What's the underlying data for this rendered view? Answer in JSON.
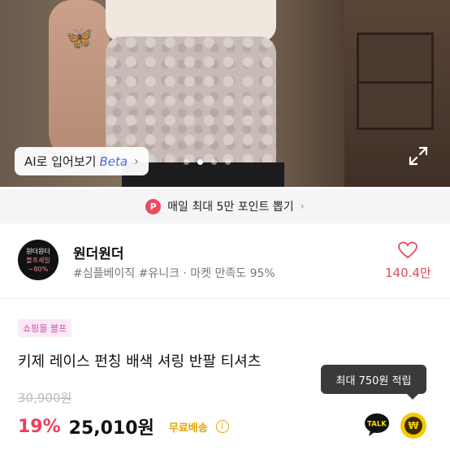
{
  "hero": {
    "ai_try_on_label": "AI로 입어보기",
    "ai_try_on_beta": "Beta",
    "ai_try_on_chevron": "›",
    "expand_icon": "expand-icon",
    "carousel_total": 4,
    "carousel_active_index": 1
  },
  "point_banner": {
    "badge": "P",
    "text": "매일 최대 5만 포인트 뽑기",
    "chevron": "›"
  },
  "shop": {
    "logo_line1": "원더원더",
    "logo_line2": "블프세일",
    "logo_line3": "~80%",
    "name": "원더원더",
    "tags": "#심플베이직 #유니크 · 마켓 만족도 95%",
    "like_count": "140.4만"
  },
  "product": {
    "mall_badge": "쇼핑몰 블프",
    "title": "키제 레이스 펀칭 배색 셔링 반팔 티셔츠",
    "original_price": "30,900원",
    "discount": "19%",
    "price": "25,010원",
    "shipping": "무료배송",
    "info_icon_glyph": "i"
  },
  "tooltip": {
    "text": "최대 750원 적립"
  },
  "actions": {
    "talk_label": "TALK",
    "won_glyph": "₩"
  },
  "colors": {
    "accent_red": "#ee3f5e",
    "like_red": "#e24b5d",
    "shipping_yellow": "#e8a400",
    "badge_pink": "#d84bb0",
    "beta_blue": "#4a6ee0"
  }
}
